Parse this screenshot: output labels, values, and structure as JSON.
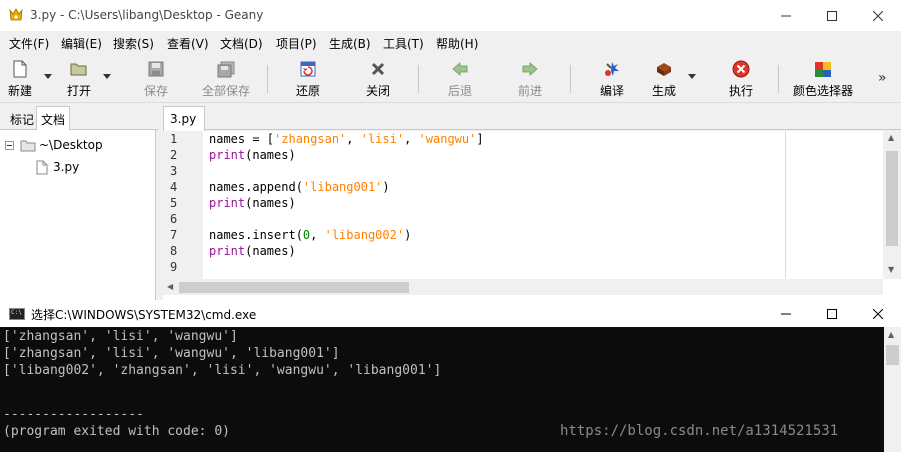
{
  "geany": {
    "title": "3.py - C:\\Users\\libang\\Desktop - Geany",
    "menu": [
      "文件(F)",
      "编辑(E)",
      "搜索(S)",
      "查看(V)",
      "文档(D)",
      "项目(P)",
      "生成(B)",
      "工具(T)",
      "帮助(H)"
    ],
    "toolbar": {
      "new": "新建",
      "open": "打开",
      "save": "保存",
      "save_all": "全部保存",
      "revert": "还原",
      "close": "关闭",
      "back": "后退",
      "forward": "前进",
      "compile": "编译",
      "build": "生成",
      "execute": "执行",
      "color_chooser": "颜色选择器",
      "more": "»"
    },
    "sidebar": {
      "tabs": [
        "标记",
        "文档"
      ],
      "folder": "~\\Desktop",
      "file": "3.py"
    },
    "editor": {
      "tab": "3.py",
      "line_numbers": [
        "1",
        "2",
        "3",
        "4",
        "5",
        "6",
        "7",
        "8",
        "9"
      ],
      "code": {
        "l1": {
          "a": "names = [",
          "s1": "'zhangsan'",
          "c1": ", ",
          "s2": "'lisi'",
          "c2": ", ",
          "s3": "'wangwu'",
          "b": "]"
        },
        "l2": {
          "kw": "print",
          "rest": "(names)"
        },
        "l4": {
          "a": "names.append(",
          "s": "'libang001'",
          "b": ")"
        },
        "l5": {
          "kw": "print",
          "rest": "(names)"
        },
        "l7": {
          "a": "names.insert(",
          "n": "0",
          "c": ", ",
          "s": "'libang002'",
          "b": ")"
        },
        "l8": {
          "kw": "print",
          "rest": "(names)"
        }
      }
    }
  },
  "cmd": {
    "title": "选择C:\\WINDOWS\\SYSTEM32\\cmd.exe",
    "icon_text": "C:\\",
    "output": [
      "['zhangsan', 'lisi', 'wangwu']",
      "['zhangsan', 'lisi', 'wangwu', 'libang001']",
      "['libang002', 'zhangsan', 'lisi', 'wangwu', 'libang001']",
      "",
      "",
      "------------------",
      "(program exited with code: 0)"
    ],
    "watermark": "https://blog.csdn.net/a1314521531"
  },
  "colors": {
    "keyword": "#991199",
    "string": "#ff8000",
    "number": "#007f00",
    "console_bg": "#0c0c0c",
    "console_text": "#c0c0c0"
  }
}
